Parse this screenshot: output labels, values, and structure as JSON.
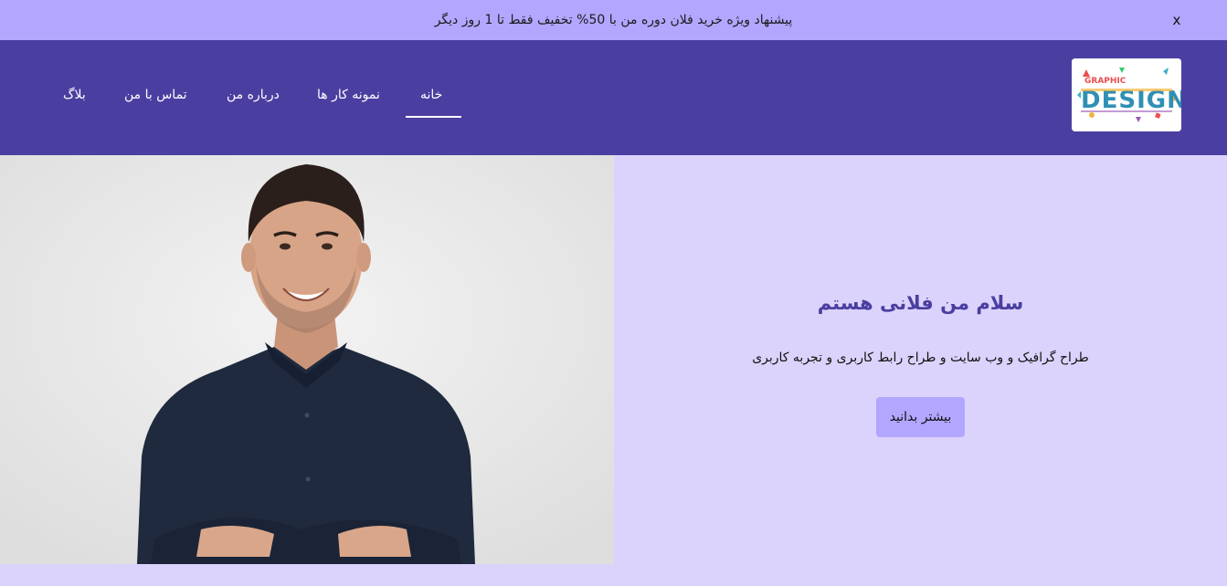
{
  "promo": {
    "text": "پیشنهاد ویژه خرید فلان دوره من با 50% تخفیف فقط تا 1 روز دیگر",
    "close_label": "x"
  },
  "logo": {
    "line1": "GRAPHIC",
    "line2": "DESIGN"
  },
  "nav": {
    "items": [
      {
        "label": "خانه",
        "active": true
      },
      {
        "label": "نمونه کار ها",
        "active": false
      },
      {
        "label": "درباره من",
        "active": false
      },
      {
        "label": "تماس با من",
        "active": false
      },
      {
        "label": "بلاگ",
        "active": false
      }
    ]
  },
  "hero": {
    "title": "سلام من فلانی هستم",
    "subtitle": "طراح گرافیک و وب سایت و طراح رابط کاربری و تجربه کاربری",
    "button_label": "بیشتر بدانید"
  },
  "colors": {
    "promo_bg": "#b2a6ff",
    "nav_bg": "#4a3fa0",
    "hero_bg": "#dbd3fc",
    "accent": "#b2a6ff",
    "title": "#4a3fa0"
  }
}
